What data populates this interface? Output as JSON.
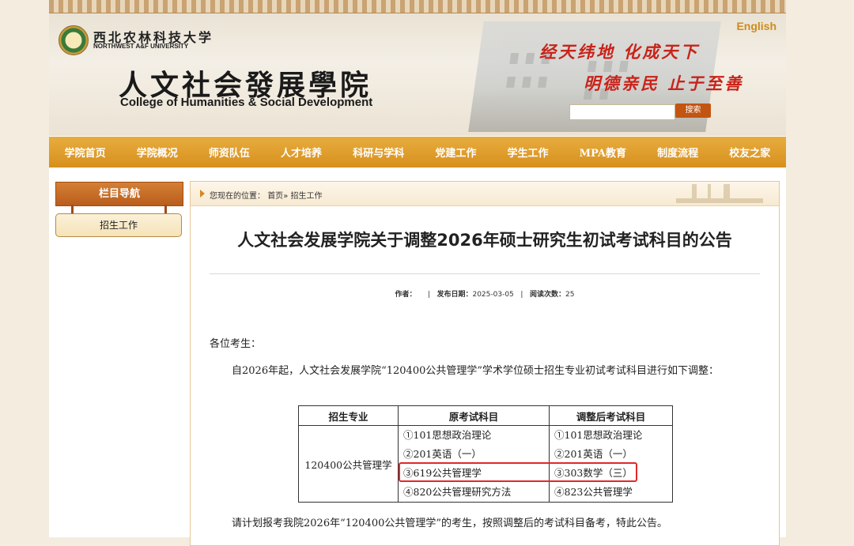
{
  "header": {
    "university_cn": "西北农林科技大学",
    "university_en": "NORTHWEST A&F UNIVERSITY",
    "college_cn": "人文社会發展學院",
    "college_en": "College of Humanities & Social Development",
    "english_link": "English",
    "motto_line1": "经天纬地  化成天下",
    "motto_line2": "明德亲民  止于至善",
    "search_placeholder": "",
    "search_button": "搜索"
  },
  "nav": {
    "items": [
      "学院首页",
      "学院概况",
      "师资队伍",
      "人才培养",
      "科研与学科",
      "党建工作",
      "学生工作",
      "MPA教育",
      "制度流程",
      "校友之家"
    ]
  },
  "sidebar": {
    "title": "栏目导航",
    "items": [
      "招生工作"
    ]
  },
  "breadcrumb": {
    "prefix": "您现在的位置：",
    "home": "首页",
    "sep": "»",
    "current": "招生工作"
  },
  "article": {
    "title": "人文社会发展学院关于调整2026年硕士研究生初试考试科目的公告",
    "author_label": "作者：",
    "author": "",
    "date_label": "发布日期：",
    "date": "2025-03-05",
    "views_label": "阅读次数：",
    "views": "25",
    "greeting": "各位考生：",
    "para1": "自2026年起，人文社会发展学院“120400公共管理学”学术学位硕士招生专业初试考试科目进行如下调整：",
    "closing": "请计划报考我院2026年“120400公共管理学”的考生，按照调整后的考试科目备考，特此公告。"
  },
  "table": {
    "headers": [
      "招生专业",
      "原考试科目",
      "调整后考试科目"
    ],
    "major": "120400公共管理学",
    "original": [
      "①101思想政治理论",
      "②201英语（一）",
      "③619公共管理学",
      "④820公共管理研究方法"
    ],
    "adjusted": [
      "①101思想政治理论",
      "②201英语（一）",
      "③303数学（三）",
      "④823公共管理学"
    ]
  },
  "colors": {
    "nav_bg": "#d88f1c",
    "motto": "#c8231a",
    "highlight": "#e0282b"
  }
}
